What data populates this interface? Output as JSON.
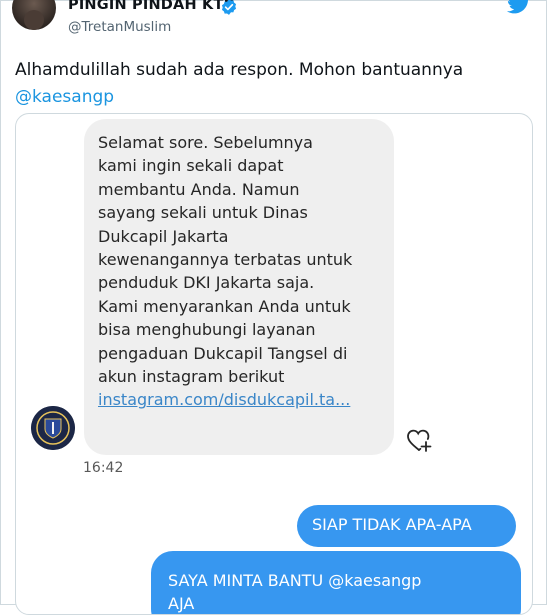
{
  "tweet": {
    "display_name": "PINGIN PINDAH KTP",
    "handle": "@TretanMuslim",
    "text_line1": "Alhamdulillah sudah ada respon. Mohon bantuannya",
    "mention": "@kaesangp"
  },
  "media": {
    "incoming_message": {
      "lines": [
        "Selamat sore. Sebelumnya",
        "kami ingin sekali dapat",
        "membantu Anda. Namun",
        "sayang sekali untuk Dinas",
        "Dukcapil Jakarta",
        "kewenangannya terbatas untuk",
        "penduduk DKI Jakarta saja.",
        "Kami menyarankan Anda untuk",
        "bisa menghubungi layanan",
        "pengaduan Dukcapil Tangsel di",
        "akun instagram berikut"
      ],
      "link": "instagram.com/disdukcapil.ta..."
    },
    "time": "16:42",
    "outgoing_messages": [
      "SIAP TIDAK APA-APA",
      "SAYA MINTA BANTU @kaesangp",
      "AJA"
    ]
  },
  "colors": {
    "twitter_blue": "#1d9bf0",
    "mention": "#1b95e0",
    "ig_blue_bubble": "#3797f0",
    "incoming_bubble": "#efefef"
  },
  "icons": [
    "verified-badge-icon",
    "twitter-bird-icon",
    "heart-plus-icon"
  ]
}
